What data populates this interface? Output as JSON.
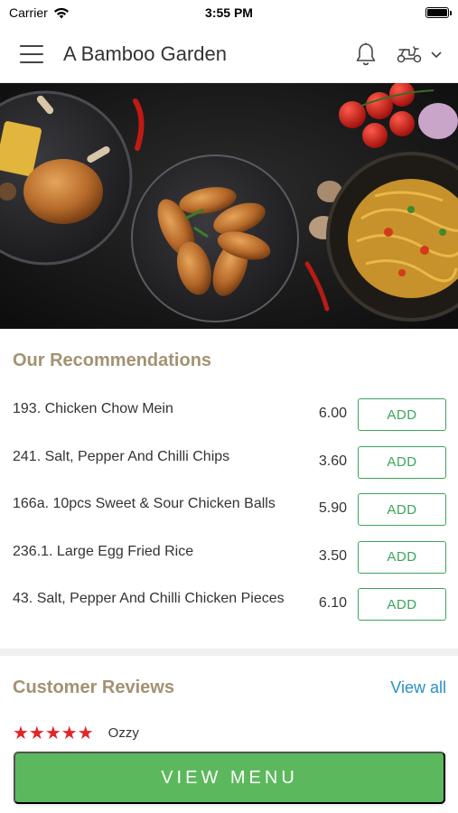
{
  "status_bar": {
    "carrier": "Carrier",
    "time": "3:55 PM"
  },
  "header": {
    "title": "A Bamboo Garden"
  },
  "recommendations": {
    "title": "Our Recommendations",
    "items": [
      {
        "name": "193. Chicken Chow Mein",
        "price": "6.00",
        "button": "ADD"
      },
      {
        "name": "241. Salt, Pepper And Chilli Chips",
        "price": "3.60",
        "button": "ADD"
      },
      {
        "name": "166a. 10pcs Sweet & Sour Chicken Balls",
        "price": "5.90",
        "button": "ADD"
      },
      {
        "name": "236.1. Large Egg Fried Rice",
        "price": "3.50",
        "button": "ADD"
      },
      {
        "name": "43. Salt, Pepper And Chilli Chicken Pieces",
        "price": "6.10",
        "button": "ADD"
      }
    ]
  },
  "reviews": {
    "title": "Customer Reviews",
    "view_all": "View all",
    "first": {
      "stars": "★★★★★",
      "rating": 5,
      "name": "Ozzy"
    }
  },
  "footer": {
    "button": "VIEW MENU"
  },
  "colors": {
    "accent_green": "#5cb85c",
    "add_green": "#3aa55a",
    "section_title": "#a39272",
    "link": "#2a8fc4",
    "stars": "#e0252b"
  }
}
